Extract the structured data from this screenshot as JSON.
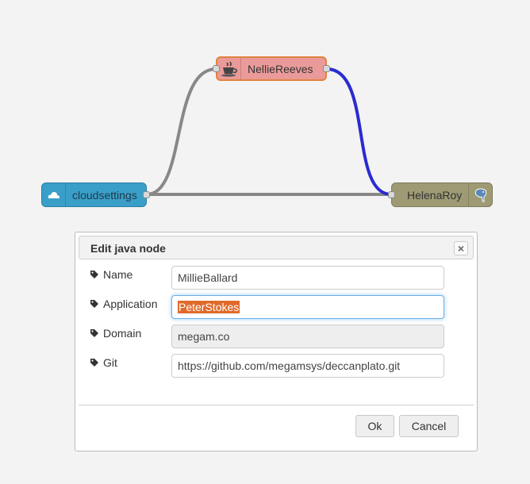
{
  "nodes": {
    "cloud": {
      "label": "cloudsettings",
      "icon": "cloud-icon"
    },
    "nellie": {
      "label": "NellieReeves",
      "icon": "java-cup-icon"
    },
    "helena": {
      "label": "HelenaRoy",
      "icon": "postgresql-elephant-icon"
    }
  },
  "colors": {
    "cloud_node": "#3a9fc8",
    "nellie_node": "#ea9a98",
    "helena_node": "#9e9a73",
    "wire_default": "#888888",
    "wire_selected": "#2b2bd0",
    "selection_highlight": "#e06a2a"
  },
  "dialog": {
    "title": "Edit java node",
    "close_glyph": "×",
    "fields": {
      "name": {
        "label": "Name",
        "value": "MillieBallard"
      },
      "application": {
        "label": "Application",
        "value": "PeterStokes"
      },
      "domain": {
        "label": "Domain",
        "value": "megam.co"
      },
      "git": {
        "label": "Git",
        "value": "https://github.com/megamsys/deccanplato.git"
      }
    },
    "ok_label": "Ok",
    "cancel_label": "Cancel"
  }
}
